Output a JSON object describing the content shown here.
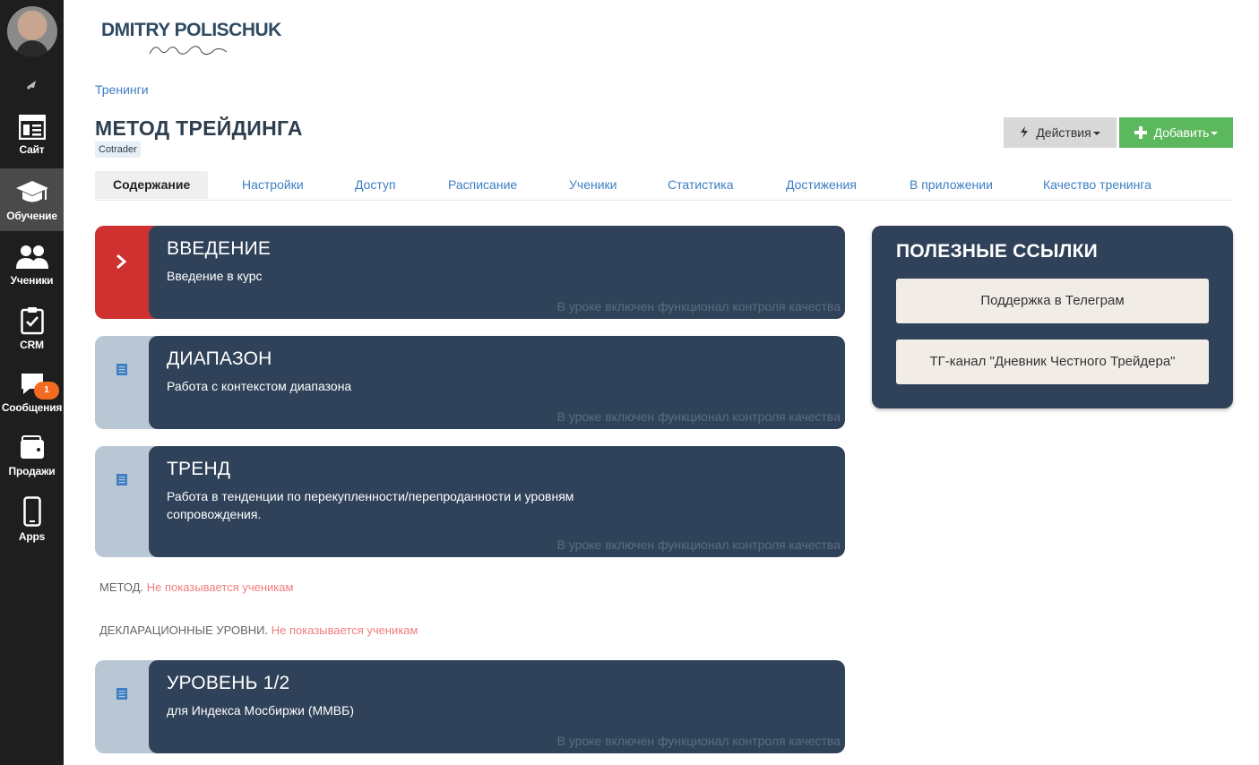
{
  "sidebar": {
    "items": [
      {
        "label": "Сайт",
        "icon": "site-icon"
      },
      {
        "label": "Обучение",
        "icon": "graduation-cap-icon",
        "active": true
      },
      {
        "label": "Ученики",
        "icon": "users-icon"
      },
      {
        "label": "CRM",
        "icon": "clipboard-check-icon"
      },
      {
        "label": "Сообщения",
        "icon": "chat-icon",
        "badge": "1"
      },
      {
        "label": "Продажи",
        "icon": "wallet-icon"
      },
      {
        "label": "Apps",
        "icon": "phone-icon"
      }
    ]
  },
  "header": {
    "logo_name": "DMITRY POLISCHUK",
    "breadcrumb": "Тренинги",
    "title": "МЕТОД ТРЕЙДИНГА",
    "tag": "Cotrader",
    "actions_label": "Действия",
    "add_label": "Добавить"
  },
  "tabs": [
    {
      "label": "Содержание",
      "active": true
    },
    {
      "label": "Настройки"
    },
    {
      "label": "Доступ"
    },
    {
      "label": "Расписание"
    },
    {
      "label": "Ученики"
    },
    {
      "label": "Статистика"
    },
    {
      "label": "Достижения"
    },
    {
      "label": "В приложении"
    },
    {
      "label": "Качество тренинга"
    }
  ],
  "lessons": [
    {
      "title": "ВВЕДЕНИЕ",
      "desc": "Введение в курс",
      "qc": "В уроке включен функционал контроля качества"
    },
    {
      "title": "ДИАПАЗОН",
      "desc": "Работа с контекстом диапазона",
      "qc": "В уроке включен функционал контроля качества"
    },
    {
      "title": "ТРЕНД",
      "desc": "Работа в тенденции по перекупленности/перепроданности и уровням сопровождения.",
      "qc": "В уроке включен функционал контроля качества"
    },
    {
      "title": "УРОВЕНЬ 1/2",
      "desc": "для Индекса Мосбиржи (ММВБ)",
      "qc": "В уроке включен функционал контроля качества"
    }
  ],
  "sections": [
    {
      "name": "МЕТОД.",
      "note": "Не показывается ученикам"
    },
    {
      "name": "ДЕКЛАРАЦИОННЫЕ УРОВНИ.",
      "note": "Не показывается ученикам"
    }
  ],
  "panel": {
    "title": "ПОЛЕЗНЫЕ ССЫЛКИ",
    "links": [
      "Поддержка в Телеграм",
      "ТГ-канал \"Дневник Честного Трейдера\""
    ]
  },
  "colors": {
    "sidebar_bg": "#1e1e1e",
    "card_bg": "#2f4259",
    "active_lesson": "#cf3030",
    "add_button": "#5cb85c",
    "link_blue": "#3d7ec4",
    "hidden_note": "#f07c7c"
  }
}
